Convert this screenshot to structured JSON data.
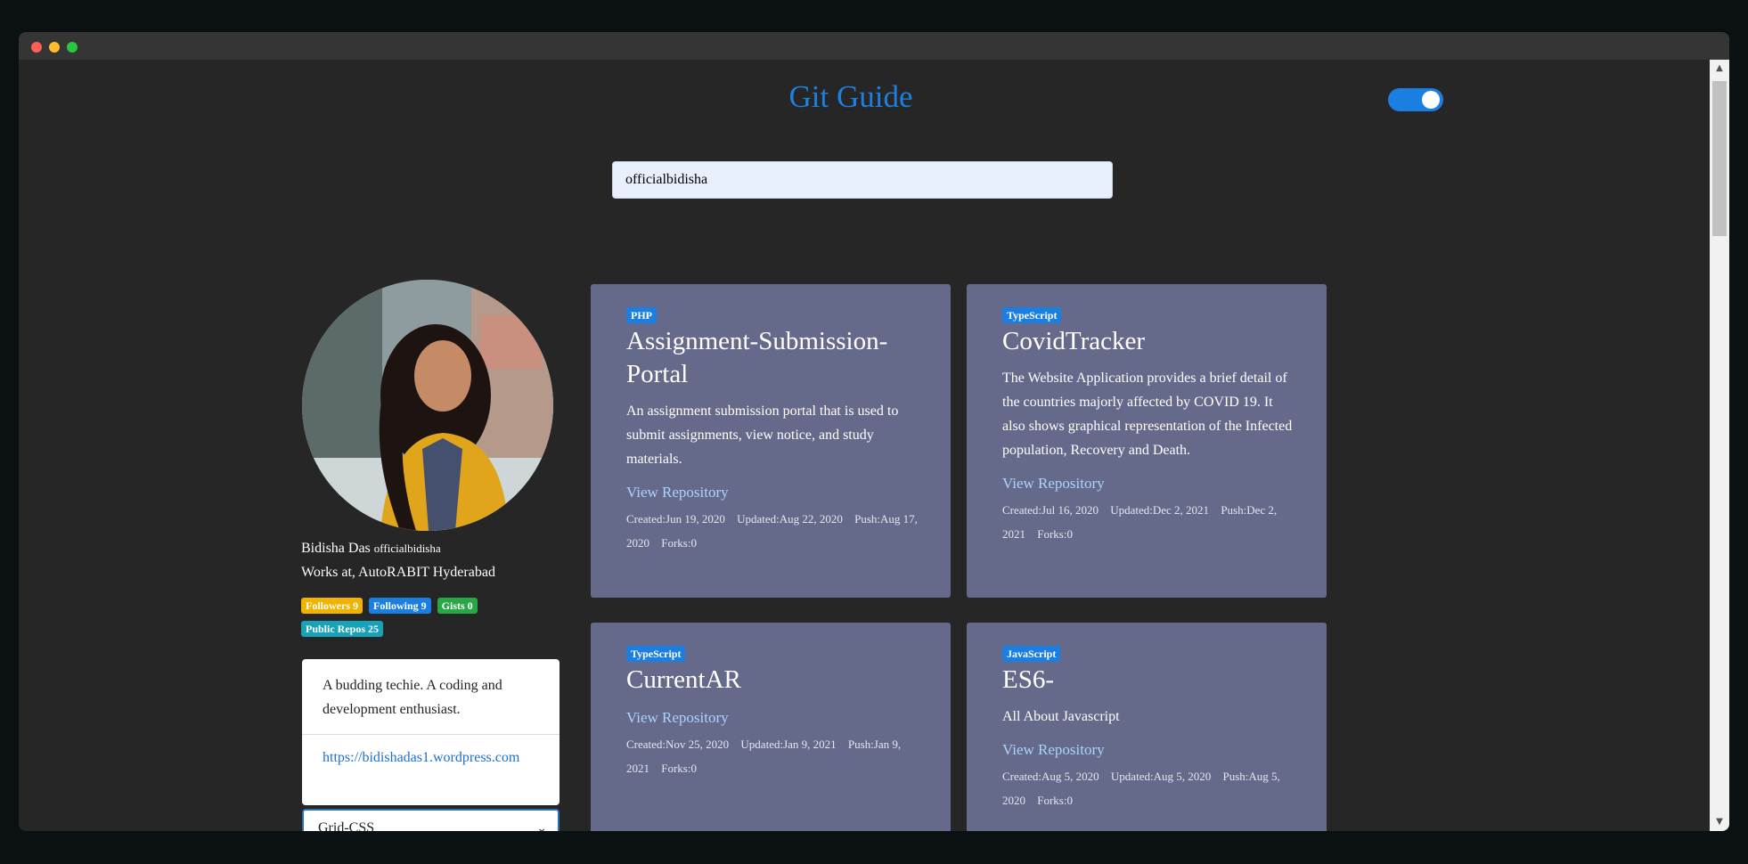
{
  "app": {
    "title": "Git Guide",
    "toggle_on": true,
    "accent_color": "#1e7fdc"
  },
  "search": {
    "value": "officialbidisha"
  },
  "profile": {
    "name": "Bidisha Das",
    "login": "officialbidisha",
    "work": "Works at, AutoRABIT Hyderabad",
    "badges": {
      "followers": "Followers 9",
      "following": "Following 9",
      "gists": "Gists 0",
      "repos": "Public Repos 25"
    },
    "bio": "A budding techie. A coding and development enthusiast.",
    "blog": "https://bidishadas1.wordpress.com",
    "layout_select": "Grid-CSS"
  },
  "repos": [
    {
      "language": "PHP",
      "name": "Assignment-Submission-Portal",
      "description": "An assignment submission portal that is used to submit assignments, view notice, and study materials.",
      "view_label": "View Repository",
      "created": "Created:Jun 19, 2020",
      "updated": "Updated:Aug 22, 2020",
      "push": "Push:Aug 17, 2020",
      "forks": "Forks:0"
    },
    {
      "language": "TypeScript",
      "name": "CovidTracker",
      "description": "The Website Application provides a brief detail of the countries majorly affected by COVID 19. It also shows graphical representation of the Infected population, Recovery and Death.",
      "view_label": "View Repository",
      "created": "Created:Jul 16, 2020",
      "updated": "Updated:Dec 2, 2021",
      "push": "Push:Dec 2, 2021",
      "forks": "Forks:0"
    },
    {
      "language": "TypeScript",
      "name": "CurrentAR",
      "description": "",
      "view_label": "View Repository",
      "created": "Created:Nov 25, 2020",
      "updated": "Updated:Jan 9, 2021",
      "push": "Push:Jan 9, 2021",
      "forks": "Forks:0"
    },
    {
      "language": "JavaScript",
      "name": "ES6-",
      "description": "All About Javascript",
      "view_label": "View Repository",
      "created": "Created:Aug 5, 2020",
      "updated": "Updated:Aug 5, 2020",
      "push": "Push:Aug 5, 2020",
      "forks": "Forks:0"
    }
  ]
}
